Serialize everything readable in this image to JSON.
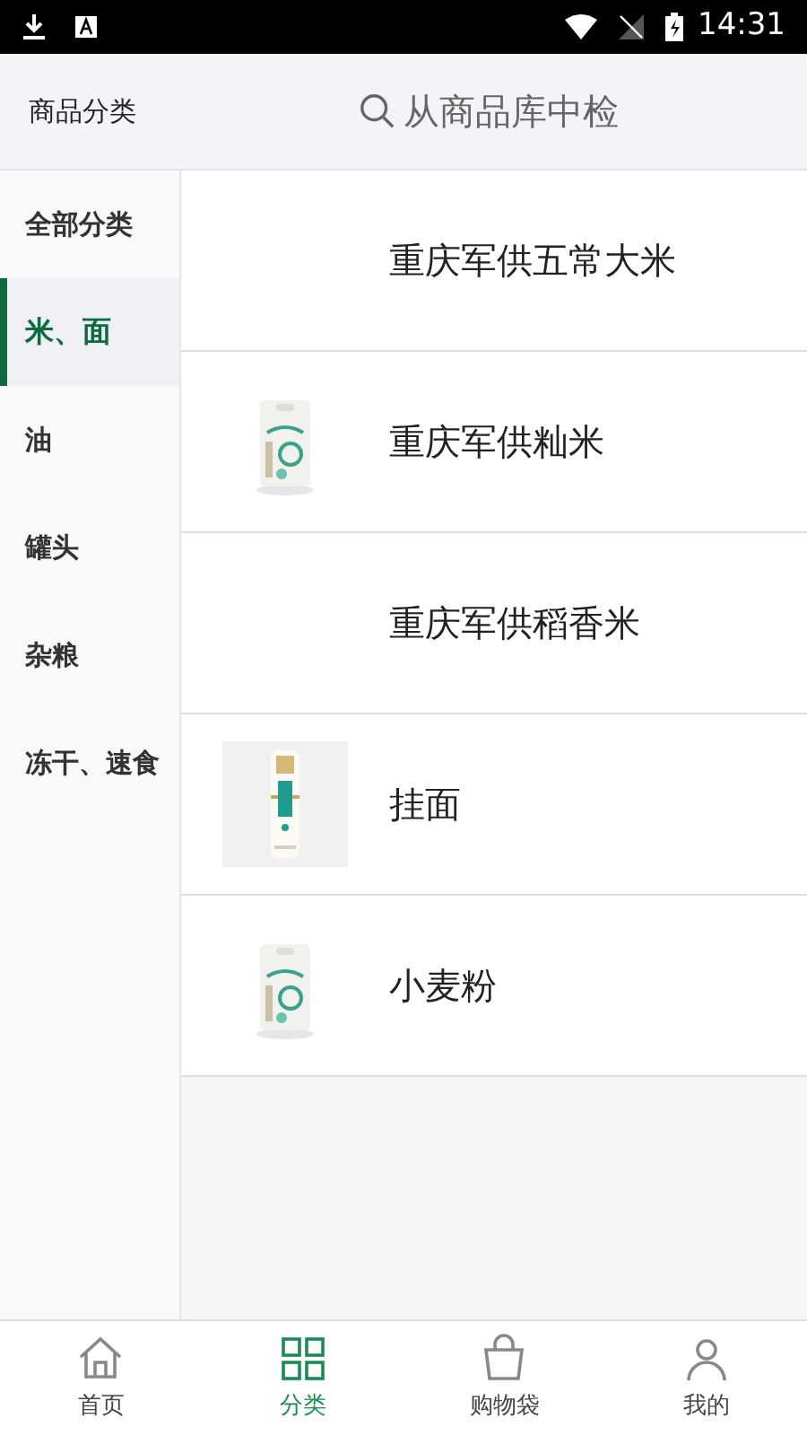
{
  "status_bar": {
    "time": "14:31"
  },
  "header": {
    "title": "商品分类",
    "search": {
      "placeholder": "从商品库中检"
    }
  },
  "sidebar": {
    "items": [
      {
        "label": "全部分类",
        "selected": false
      },
      {
        "label": "米、面",
        "selected": true
      },
      {
        "label": "油",
        "selected": false
      },
      {
        "label": "罐头",
        "selected": false
      },
      {
        "label": "杂粮",
        "selected": false
      },
      {
        "label": "冻干、速食",
        "selected": false
      }
    ]
  },
  "products": [
    {
      "name": "重庆军供五常大米",
      "kind": "plain"
    },
    {
      "name": "重庆军供籼米",
      "kind": "picture"
    },
    {
      "name": "重庆军供稻香米",
      "kind": "plain"
    },
    {
      "name": "挂面",
      "kind": "picture"
    },
    {
      "name": "小麦粉",
      "kind": "picture"
    }
  ],
  "tab_bar": {
    "items": [
      {
        "label": "首页",
        "selected": false
      },
      {
        "label": "分类",
        "selected": true
      },
      {
        "label": "购物袋",
        "selected": false
      },
      {
        "label": "我的",
        "selected": false
      }
    ]
  }
}
